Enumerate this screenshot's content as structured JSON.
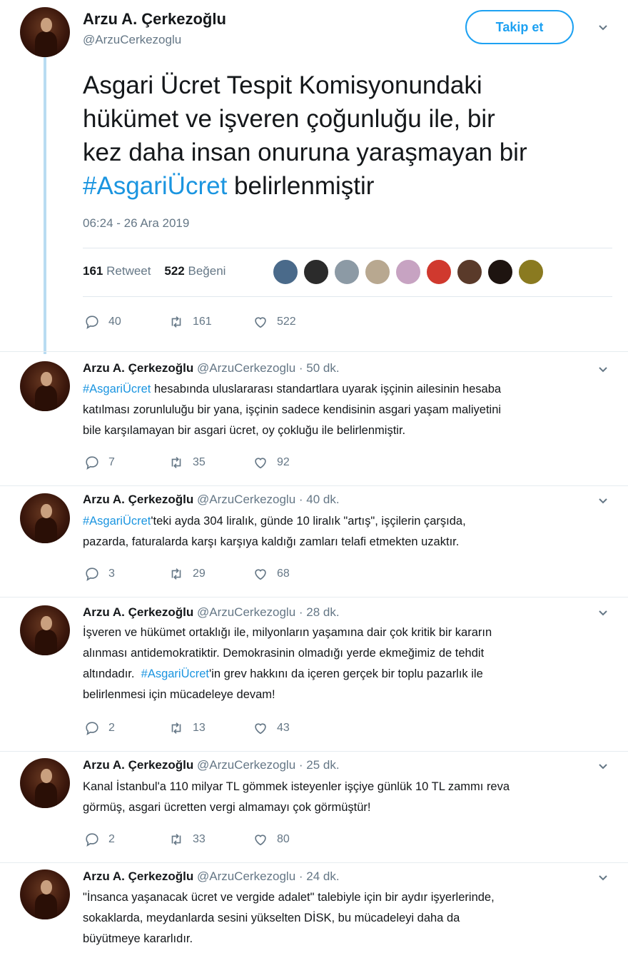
{
  "main": {
    "name": "Arzu A. Çerkezoğlu",
    "handle": "@ArzuCerkezoglu",
    "follow_label": "Takip et",
    "text_lines": [
      "Asgari Ücret Tespit Komisyonundaki",
      "hükümet ve işveren çoğunluğu ile, bir",
      "kez daha insan onuruna yaraşmayan bir"
    ],
    "hashtag": "#AsgariÜcret",
    "text_tail": " belirlenmiştir",
    "timestamp": "06:24 - 26 Ara 2019",
    "retweet_count": "161",
    "retweet_label": "Retweet",
    "like_count": "522",
    "like_label": "Beğeni",
    "action_replies": "40",
    "action_retweets": "161",
    "action_likes": "522"
  },
  "replies": [
    {
      "name": "Arzu A. Çerkezoğlu",
      "meta": "@ArzuCerkezoglu · 50 dk.",
      "hashtag": "#AsgariÜcret",
      "text_after_hashtag": " hesabında uluslararası standartlara uyarak işçinin ailesinin hesaba",
      "lines": [
        "katılması zorunluluğu bir yana, işçinin sadece kendisinin asgari yaşam maliyetini",
        "bile karşılamayan bir asgari ücret, oy çokluğu ile belirlenmiştir."
      ],
      "replies": "7",
      "retweets": "35",
      "likes": "92"
    },
    {
      "name": "Arzu A. Çerkezoğlu",
      "meta": "@ArzuCerkezoglu · 40 dk.",
      "hashtag": "#AsgariÜcret",
      "text_after_hashtag": "'teki ayda 304 liralık, günde 10 liralık \"artış\", işçilerin çarşıda,",
      "lines": [
        "pazarda, faturalarda karşı karşıya kaldığı zamları telafi etmekten uzaktır."
      ],
      "replies": "3",
      "retweets": "29",
      "likes": "68"
    },
    {
      "name": "Arzu A. Çerkezoğlu",
      "meta": "@ArzuCerkezoglu · 28 dk.",
      "line1": "İşveren ve hükümet ortaklığı ile, milyonların yaşamına dair çok kritik bir kararın",
      "line2": "alınması antidemokratiktir. Demokrasinin olmadığı yerde ekmeğimiz de tehdit",
      "line3_before": "altındadır.  ",
      "hashtag": "#AsgariÜcret",
      "line3_after": "'in grev hakkını da içeren gerçek bir toplu pazarlık ile",
      "line4": "belirlenmesi için mücadeleye devam!",
      "replies": "2",
      "retweets": "13",
      "likes": "43"
    },
    {
      "name": "Arzu A. Çerkezoğlu",
      "meta": "@ArzuCerkezoglu · 25 dk.",
      "lines": [
        "Kanal İstanbul'a 110 milyar TL gömmek isteyenler işçiye günlük 10 TL zammı reva",
        "görmüş, asgari ücretten vergi almamayı çok görmüştür!"
      ],
      "replies": "2",
      "retweets": "33",
      "likes": "80"
    },
    {
      "name": "Arzu A. Çerkezoğlu",
      "meta": "@ArzuCerkezoglu · 24 dk.",
      "lines": [
        "\"İnsanca yaşanacak ücret ve vergide adalet\" talebiyle için bir aydır işyerlerinde,",
        "sokaklarda, meydanlarda sesini yükselten DİSK, bu mücadeleyi daha da",
        "büyütmeye kararlıdır."
      ]
    }
  ],
  "colors": {
    "accent": "#1da1f2",
    "hashtag": "#1b95e0",
    "muted": "#657786",
    "thread": "#b9dcf2"
  },
  "icons": [
    "chevron-down-icon",
    "reply-icon",
    "retweet-icon",
    "like-icon"
  ]
}
